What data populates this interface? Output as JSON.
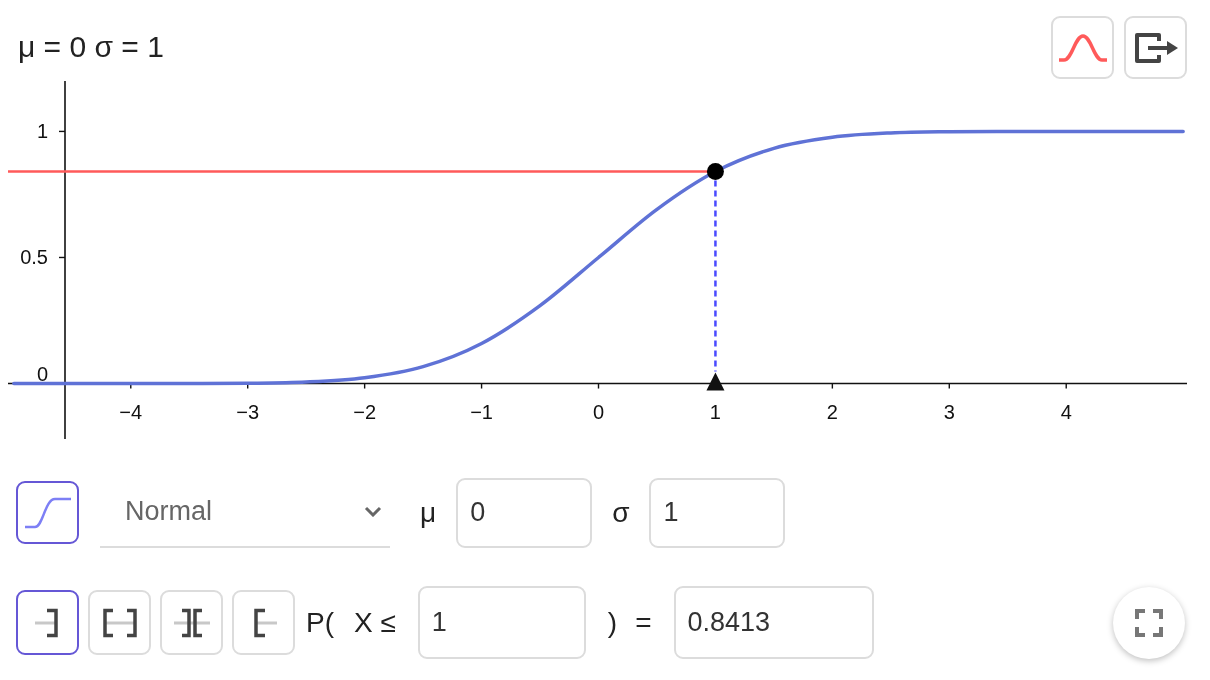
{
  "graphics_view": {
    "caption": "μ = 0 σ = 1",
    "chart_data": {
      "type": "line",
      "x": [
        -5,
        -4.5,
        -4,
        -3.5,
        -3,
        -2.5,
        -2,
        -1.5,
        -1,
        -0.5,
        0,
        0.5,
        1,
        1.5,
        2,
        2.5,
        3,
        3.5,
        4,
        4.5,
        5
      ],
      "series": [
        {
          "color": "#5f72d6",
          "values": [
            0,
            0,
            0,
            0,
            0.001,
            0.006,
            0.023,
            0.067,
            0.159,
            0.309,
            0.5,
            0.691,
            0.841,
            0.933,
            0.977,
            0.994,
            0.999,
            1,
            1,
            1,
            1
          ]
        }
      ],
      "xlim": [
        -5.05,
        5.05
      ],
      "ylim": [
        -0.22,
        1.2
      ],
      "xticks": [
        {
          "value": -4,
          "label": "−4"
        },
        {
          "value": -3,
          "label": "−3"
        },
        {
          "value": -2,
          "label": "−2"
        },
        {
          "value": -1,
          "label": "−1"
        },
        0,
        1,
        2,
        3,
        4
      ],
      "yticks": [
        0,
        0.5,
        1
      ],
      "ref_lines": [
        {
          "axis": "y",
          "value": 0.841
        },
        {
          "axis": "x",
          "value": 1
        }
      ]
    }
  },
  "distribution": {
    "cumulative_toggle": {
      "on": true
    },
    "selected_distribution": "Normal",
    "parameters": [
      {
        "label": "μ",
        "value": "0"
      },
      {
        "label": "σ",
        "value": "1"
      }
    ]
  },
  "probability": {
    "interval_modes": [
      {
        "kind": "left_sided",
        "selected": true
      },
      {
        "kind": "interval",
        "selected": false
      },
      {
        "kind": "two_tailed",
        "selected": false
      },
      {
        "kind": "right_sided",
        "selected": false
      }
    ],
    "prefix": "P(",
    "condition": "X ≤",
    "bound": "1",
    "suffix": ")",
    "equals": "=",
    "result": "0.8413"
  }
}
